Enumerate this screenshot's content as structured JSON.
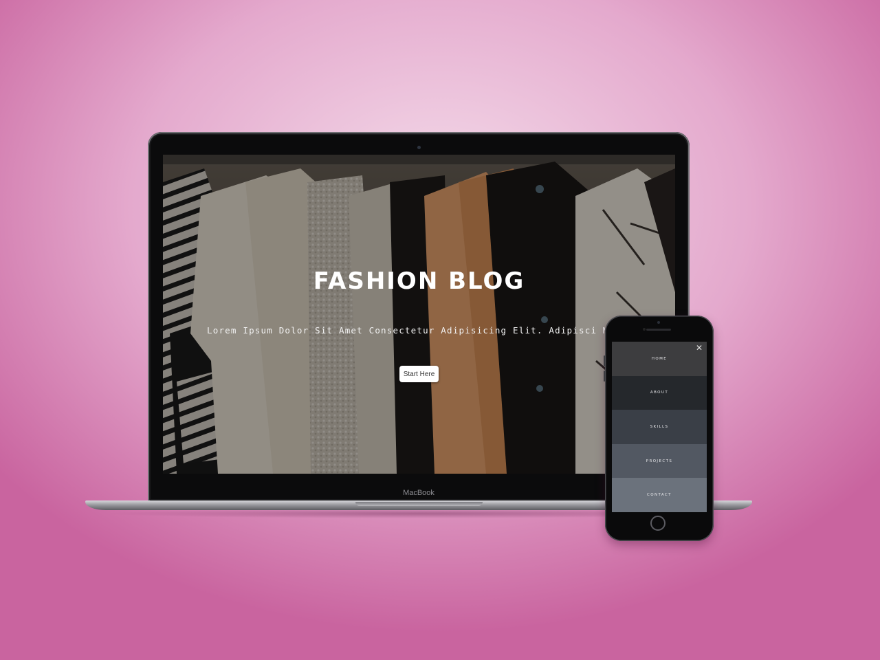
{
  "laptop": {
    "brand_label": "MacBook",
    "hero": {
      "title": "FASHION BLOG",
      "subtitle": "Lorem Ipsum Dolor Sit Amet Consectetur Adipisicing Elit. Adipisci Magni Tempo",
      "cta_label": "Start Here"
    }
  },
  "phone": {
    "close_icon": "close-icon",
    "menu": [
      {
        "label": "HOME",
        "color": "#3d3d3f"
      },
      {
        "label": "ABOUT",
        "color": "#25282c"
      },
      {
        "label": "SKILLS",
        "color": "#3a3f47"
      },
      {
        "label": "PROJECTS",
        "color": "#525862"
      },
      {
        "label": "CONTACT",
        "color": "#6b727c"
      }
    ]
  },
  "colors": {
    "background_center": "#f4dcea",
    "background_edge": "#c9649f",
    "cta_background": "#ffffff"
  }
}
